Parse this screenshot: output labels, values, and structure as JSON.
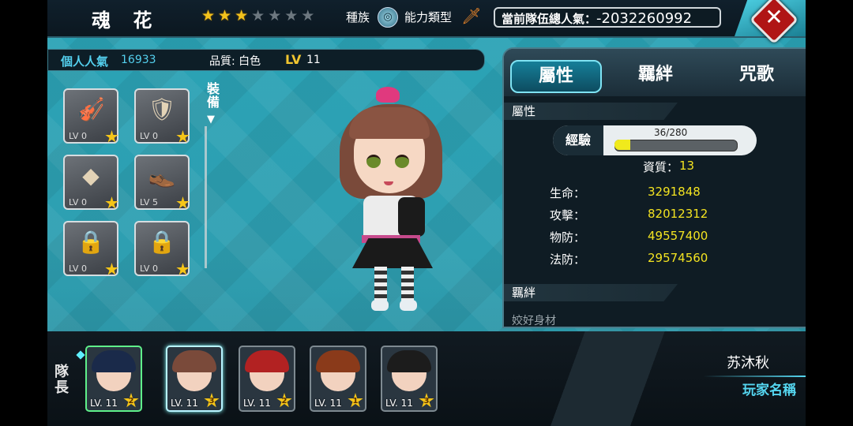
{
  "hero": {
    "name": "魂 花",
    "stars_filled": 3,
    "stars_total": 7,
    "race_label": "種族",
    "race_icon": "race-emblem-icon",
    "ability_label": "能力類型",
    "ability_icon": "sword-icon"
  },
  "team_popularity": {
    "label": "當前隊伍總人氣",
    "separator": "：",
    "value": "-2032260992"
  },
  "close_icon": "close-x-icon",
  "info": {
    "popularity_label": "個人人氣",
    "popularity_value": "16933",
    "quality_text": "品質: 白色",
    "lv_label": "LV",
    "lv_value": "11"
  },
  "equipment": {
    "tag": "裝備",
    "slots": [
      {
        "icon": "violin-icon",
        "glyph": "🎻",
        "lv": "LV 0",
        "badge": "star-badge-icon"
      },
      {
        "icon": "armor-icon",
        "glyph": "🛡",
        "lv": "LV 0",
        "badge": "star-badge-icon"
      },
      {
        "icon": "accessory-icon",
        "glyph": "◆",
        "lv": "LV 0",
        "badge": "star-badge-icon"
      },
      {
        "icon": "shoes-icon",
        "glyph": "👞",
        "lv": "LV 5",
        "badge": "star-badge-icon"
      },
      {
        "icon": "lock-green-icon",
        "glyph": "🔒",
        "lv": "LV 0",
        "badge": "star-badge-icon"
      },
      {
        "icon": "lock-gold-icon",
        "glyph": "🔒",
        "lv": "LV 0",
        "badge": "star-badge-icon"
      }
    ]
  },
  "panel": {
    "tabs": [
      "屬性",
      "羈絆",
      "咒歌"
    ],
    "active_tab": 0,
    "attr_section": "屬性",
    "exp_label": "經驗",
    "exp_text": "36/280",
    "exp_current": 36,
    "exp_max": 280,
    "aptitude_label": "資質：",
    "aptitude_value": "13",
    "stats": [
      {
        "label": "生命：",
        "value": "3291848"
      },
      {
        "label": "攻擊：",
        "value": "82012312"
      },
      {
        "label": "物防：",
        "value": "49557400"
      },
      {
        "label": "法防：",
        "value": "29574560"
      }
    ],
    "bond_section": "羈絆",
    "bond_item": "姣好身材"
  },
  "team": {
    "captain_label": "隊長",
    "members": [
      {
        "lv": "LV. 11",
        "rank": "2",
        "hair": "#1a2a4a",
        "captain": true
      },
      {
        "lv": "LV. 11",
        "rank": "3",
        "hair": "#7a4a3a",
        "selected": true
      },
      {
        "lv": "LV. 11",
        "rank": "2",
        "hair": "#b22222"
      },
      {
        "lv": "LV. 11",
        "rank": "1",
        "hair": "#8a3a1a"
      },
      {
        "lv": "LV. 11",
        "rank": "3",
        "hair": "#1c1c1c"
      }
    ]
  },
  "player": {
    "name": "苏沐秋",
    "tag": "玩家名稱"
  }
}
